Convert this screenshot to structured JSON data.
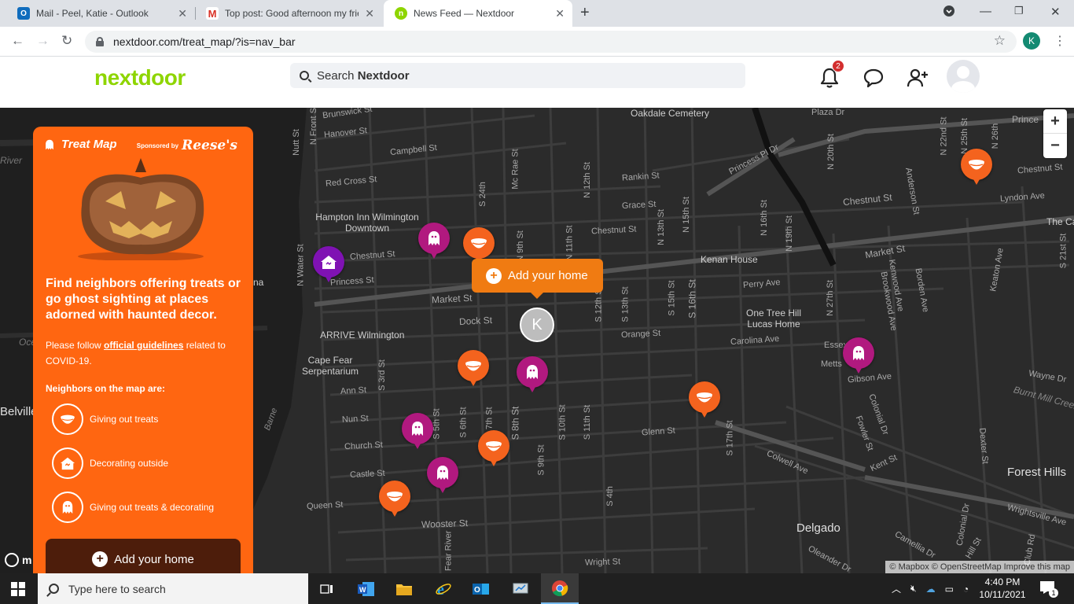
{
  "browser": {
    "tabs": [
      {
        "title": "Mail - Peel, Katie - Outlook",
        "icon": "outlook-icon"
      },
      {
        "title": "Top post: Good afternoon my frie",
        "icon": "gmail-icon"
      },
      {
        "title": "News Feed — Nextdoor",
        "icon": "nextdoor-icon"
      }
    ],
    "url": "nextdoor.com/treat_map/?is=nav_bar",
    "profile_initial": "K"
  },
  "header": {
    "logo": "nextdoor",
    "search_prefix": "Search ",
    "search_bold": "Nextdoor",
    "notification_count": "2"
  },
  "panel": {
    "title": "Treat Map",
    "sponsored_by": "Sponsored by",
    "sponsor": "Reese's",
    "headline": "Find neighbors offering treats or go ghost sighting at places adorned with haunted decor.",
    "guide_prefix": "Please follow ",
    "guide_link": "official guidelines",
    "guide_suffix": " related to COVID-19.",
    "legend_title": "Neighbors on the map are:",
    "legend": [
      {
        "label": "Giving out treats",
        "icon": "treat-bowl-icon"
      },
      {
        "label": "Decorating outside",
        "icon": "haunted-house-icon"
      },
      {
        "label": "Giving out treats & decorating",
        "icon": "ghost-icon"
      }
    ],
    "button": "Add your home"
  },
  "map": {
    "popup": "Add your home",
    "user_initial": "K",
    "zoom_in": "+",
    "zoom_out": "−",
    "attribution": "© Mapbox © OpenStreetMap Improve this map",
    "logo_letter": "m",
    "places": [
      {
        "text": "Oakdale Cemetery"
      },
      {
        "text": "Hampton Inn Wilmington Downtown"
      },
      {
        "text": "ARRIVE Wilmington"
      },
      {
        "text": "Cape Fear Serpentarium"
      },
      {
        "text": "Kenan House"
      },
      {
        "text": "One Tree Hill Lucas Home"
      },
      {
        "text": "Forest Hills"
      },
      {
        "text": "Delgado"
      },
      {
        "text": "Belville"
      },
      {
        "text": "River"
      },
      {
        "text": "Oce"
      },
      {
        "text": "na"
      },
      {
        "text": "The Ca"
      },
      {
        "text": "Burnt Mill Creek"
      }
    ],
    "streets": [
      "Brunswick St",
      "Hanover St",
      "Campbell St",
      "Red Cross St",
      "Chestnut St",
      "Princess St",
      "Market St",
      "Dock St",
      "Orange St",
      "Ann St",
      "Nun St",
      "Church St",
      "Castle St",
      "Queen St",
      "Wooster St",
      "Wright St",
      "Grace St",
      "Rankin St",
      "Princess Pl Dr",
      "Chestnut St",
      "Lyndon Ave",
      "Perry Ave",
      "Carolina Ave",
      "Glenn St",
      "Colwell Ave",
      "Gibson Ave",
      "Wayne Dr",
      "Kent St",
      "Wrightsville Ave",
      "Camellia Dr",
      "Oleander Dr",
      "Plaza Dr",
      "Prince",
      "Market St",
      "Chestnut St",
      "N Front St",
      "Nutt St",
      "N Water St",
      "S 3rd St",
      "S 5th St",
      "S 6th St",
      "S 7th St",
      "S 8th St",
      "S 9th St",
      "S 10th St",
      "S 11th St",
      "S 12th St",
      "S 13th St",
      "S 15th St",
      "S 16th St",
      "S 17th St",
      "N 9th St",
      "N 11th St",
      "N 12th St",
      "N 13th St",
      "N 15th St",
      "N 16th St",
      "N 19th St",
      "N 20th St",
      "N 22nd St",
      "N 25th St",
      "N 26th",
      "N 27th St",
      "S 21st St",
      "S 24th",
      "Mc Rae St",
      "Anderson St",
      "Kenwood Ave",
      "Brookwood Ave",
      "Borden Ave",
      "Keaton Ave",
      "Colonial Dr",
      "Fowler St",
      "Dexter St",
      "Colonial Dr",
      "Hill St",
      "Club Rd",
      "Essex",
      "Metts",
      "Barne",
      "Cape Fear River",
      "S 4th",
      "S 12th St"
    ]
  },
  "taskbar": {
    "search_placeholder": "Type here to search",
    "time": "4:40 PM",
    "date": "10/11/2021",
    "notification_count": "1"
  }
}
